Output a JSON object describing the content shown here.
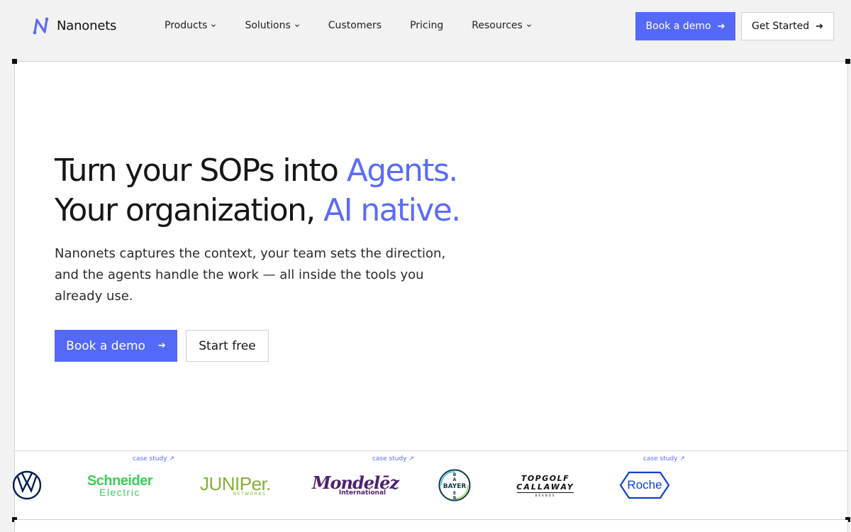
{
  "nav": {
    "brand": "Nanonets",
    "items": [
      {
        "label": "Products",
        "dropdown": true
      },
      {
        "label": "Solutions",
        "dropdown": true
      },
      {
        "label": "Customers",
        "dropdown": false
      },
      {
        "label": "Pricing",
        "dropdown": false
      },
      {
        "label": "Resources",
        "dropdown": true
      }
    ],
    "book_demo": "Book a demo",
    "get_started": "Get Started"
  },
  "hero": {
    "title_line1": "Turn your SOPs into ",
    "title_line1_accent": "Agents.",
    "title_line2": "Your organization, ",
    "title_line2_accent": "AI native.",
    "description": "Nanonets captures the context, your team sets the direction, and the agents handle the work — all inside the tools you already use.",
    "primary_cta": "Book a demo",
    "secondary_cta": "Start free"
  },
  "logos": {
    "case_study_label": "case study ↗",
    "brands": {
      "schneider_top": "Schneider",
      "schneider_bottom": "Electric",
      "juniper_top": "JUNIPer.",
      "juniper_bottom": "NETWORKS",
      "mondelez_top": "Mondelēz",
      "mondelez_bottom": "International",
      "bayer": "BAYER",
      "topgolf_top": "TOPGOLF",
      "topgolf_bottom": "CALLAWAY",
      "topgolf_sub": "BRANDS",
      "roche": "Roche"
    }
  },
  "colors": {
    "accent": "#5a6cf6",
    "button_primary": "#5469f7",
    "page_bg": "#f2f2f2"
  }
}
